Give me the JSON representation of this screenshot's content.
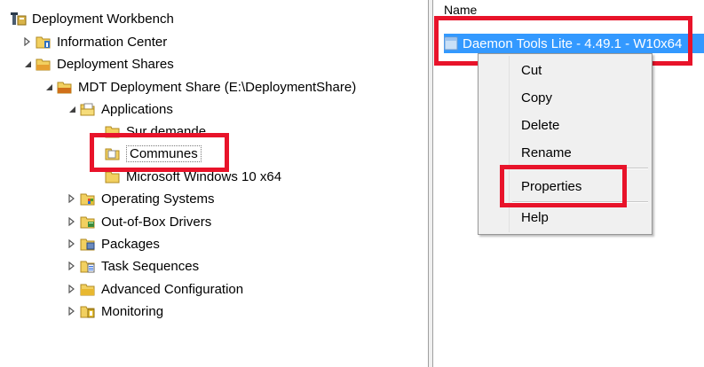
{
  "tree": {
    "root": {
      "label": "Deployment Workbench",
      "icon": "workbench-icon"
    },
    "information_center": {
      "label": "Information Center",
      "icon": "info-folder-icon"
    },
    "deployment_shares": {
      "label": "Deployment Shares",
      "icon": "folder-icon"
    },
    "mdt_share": {
      "label": "MDT Deployment Share (E:\\DeploymentShare)",
      "icon": "share-folder-icon"
    },
    "applications": {
      "label": "Applications",
      "icon": "folder-open-icon"
    },
    "sub_1": {
      "label": "Sur demande",
      "icon": "folder-icon"
    },
    "sub_2": {
      "label": "Communes",
      "icon": "folder-icon"
    },
    "sub_3": {
      "label": "Microsoft Windows 10 x64",
      "icon": "folder-icon"
    },
    "operating_systems": {
      "label": "Operating Systems",
      "icon": "os-folder-icon"
    },
    "drivers": {
      "label": "Out-of-Box Drivers",
      "icon": "drivers-folder-icon"
    },
    "packages": {
      "label": "Packages",
      "icon": "packages-folder-icon"
    },
    "task_sequences": {
      "label": "Task Sequences",
      "icon": "task-folder-icon"
    },
    "advanced_configuration": {
      "label": "Advanced Configuration",
      "icon": "folder-icon"
    },
    "monitoring": {
      "label": "Monitoring",
      "icon": "monitoring-folder-icon"
    }
  },
  "list": {
    "column_header": "Name",
    "selected_item": "Daemon Tools Lite - 4.49.1 - W10x64"
  },
  "context_menu": {
    "items": [
      "Cut",
      "Copy",
      "Delete",
      "Rename",
      "Properties",
      "Help"
    ]
  },
  "colors": {
    "highlight": "#e8132a",
    "selection": "#3399ff"
  }
}
